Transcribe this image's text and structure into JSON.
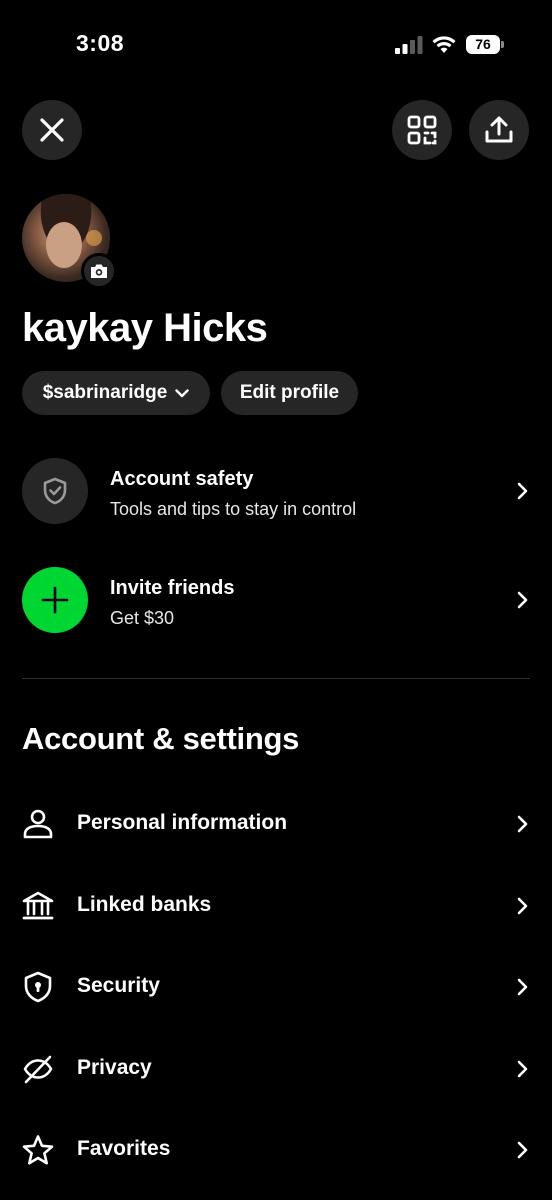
{
  "status_bar": {
    "time": "3:08",
    "battery": "76",
    "icons": [
      "cellular-signal-icon",
      "wifi-icon",
      "battery-icon"
    ]
  },
  "header": {
    "buttons": [
      "close-icon",
      "qr-scan-icon",
      "share-upload-icon"
    ]
  },
  "profile": {
    "name": "kaykay Hicks",
    "cashtag": "$sabrinaridge",
    "edit_label": "Edit profile"
  },
  "features": [
    {
      "title": "Account safety",
      "subtitle": "Tools and tips to stay in control",
      "icon": "shield-check-icon"
    },
    {
      "title": "Invite friends",
      "subtitle": "Get $30",
      "icon": "plus-icon"
    }
  ],
  "settings": {
    "title": "Account & settings",
    "items": [
      {
        "label": "Personal information",
        "icon": "person-icon"
      },
      {
        "label": "Linked banks",
        "icon": "bank-icon"
      },
      {
        "label": "Security",
        "icon": "shield-lock-icon"
      },
      {
        "label": "Privacy",
        "icon": "eye-slash-icon"
      },
      {
        "label": "Favorites",
        "icon": "star-icon"
      }
    ]
  },
  "colors": {
    "background": "#000000",
    "surface": "#262626",
    "accent_green": "#00d632",
    "text": "#ffffff"
  }
}
